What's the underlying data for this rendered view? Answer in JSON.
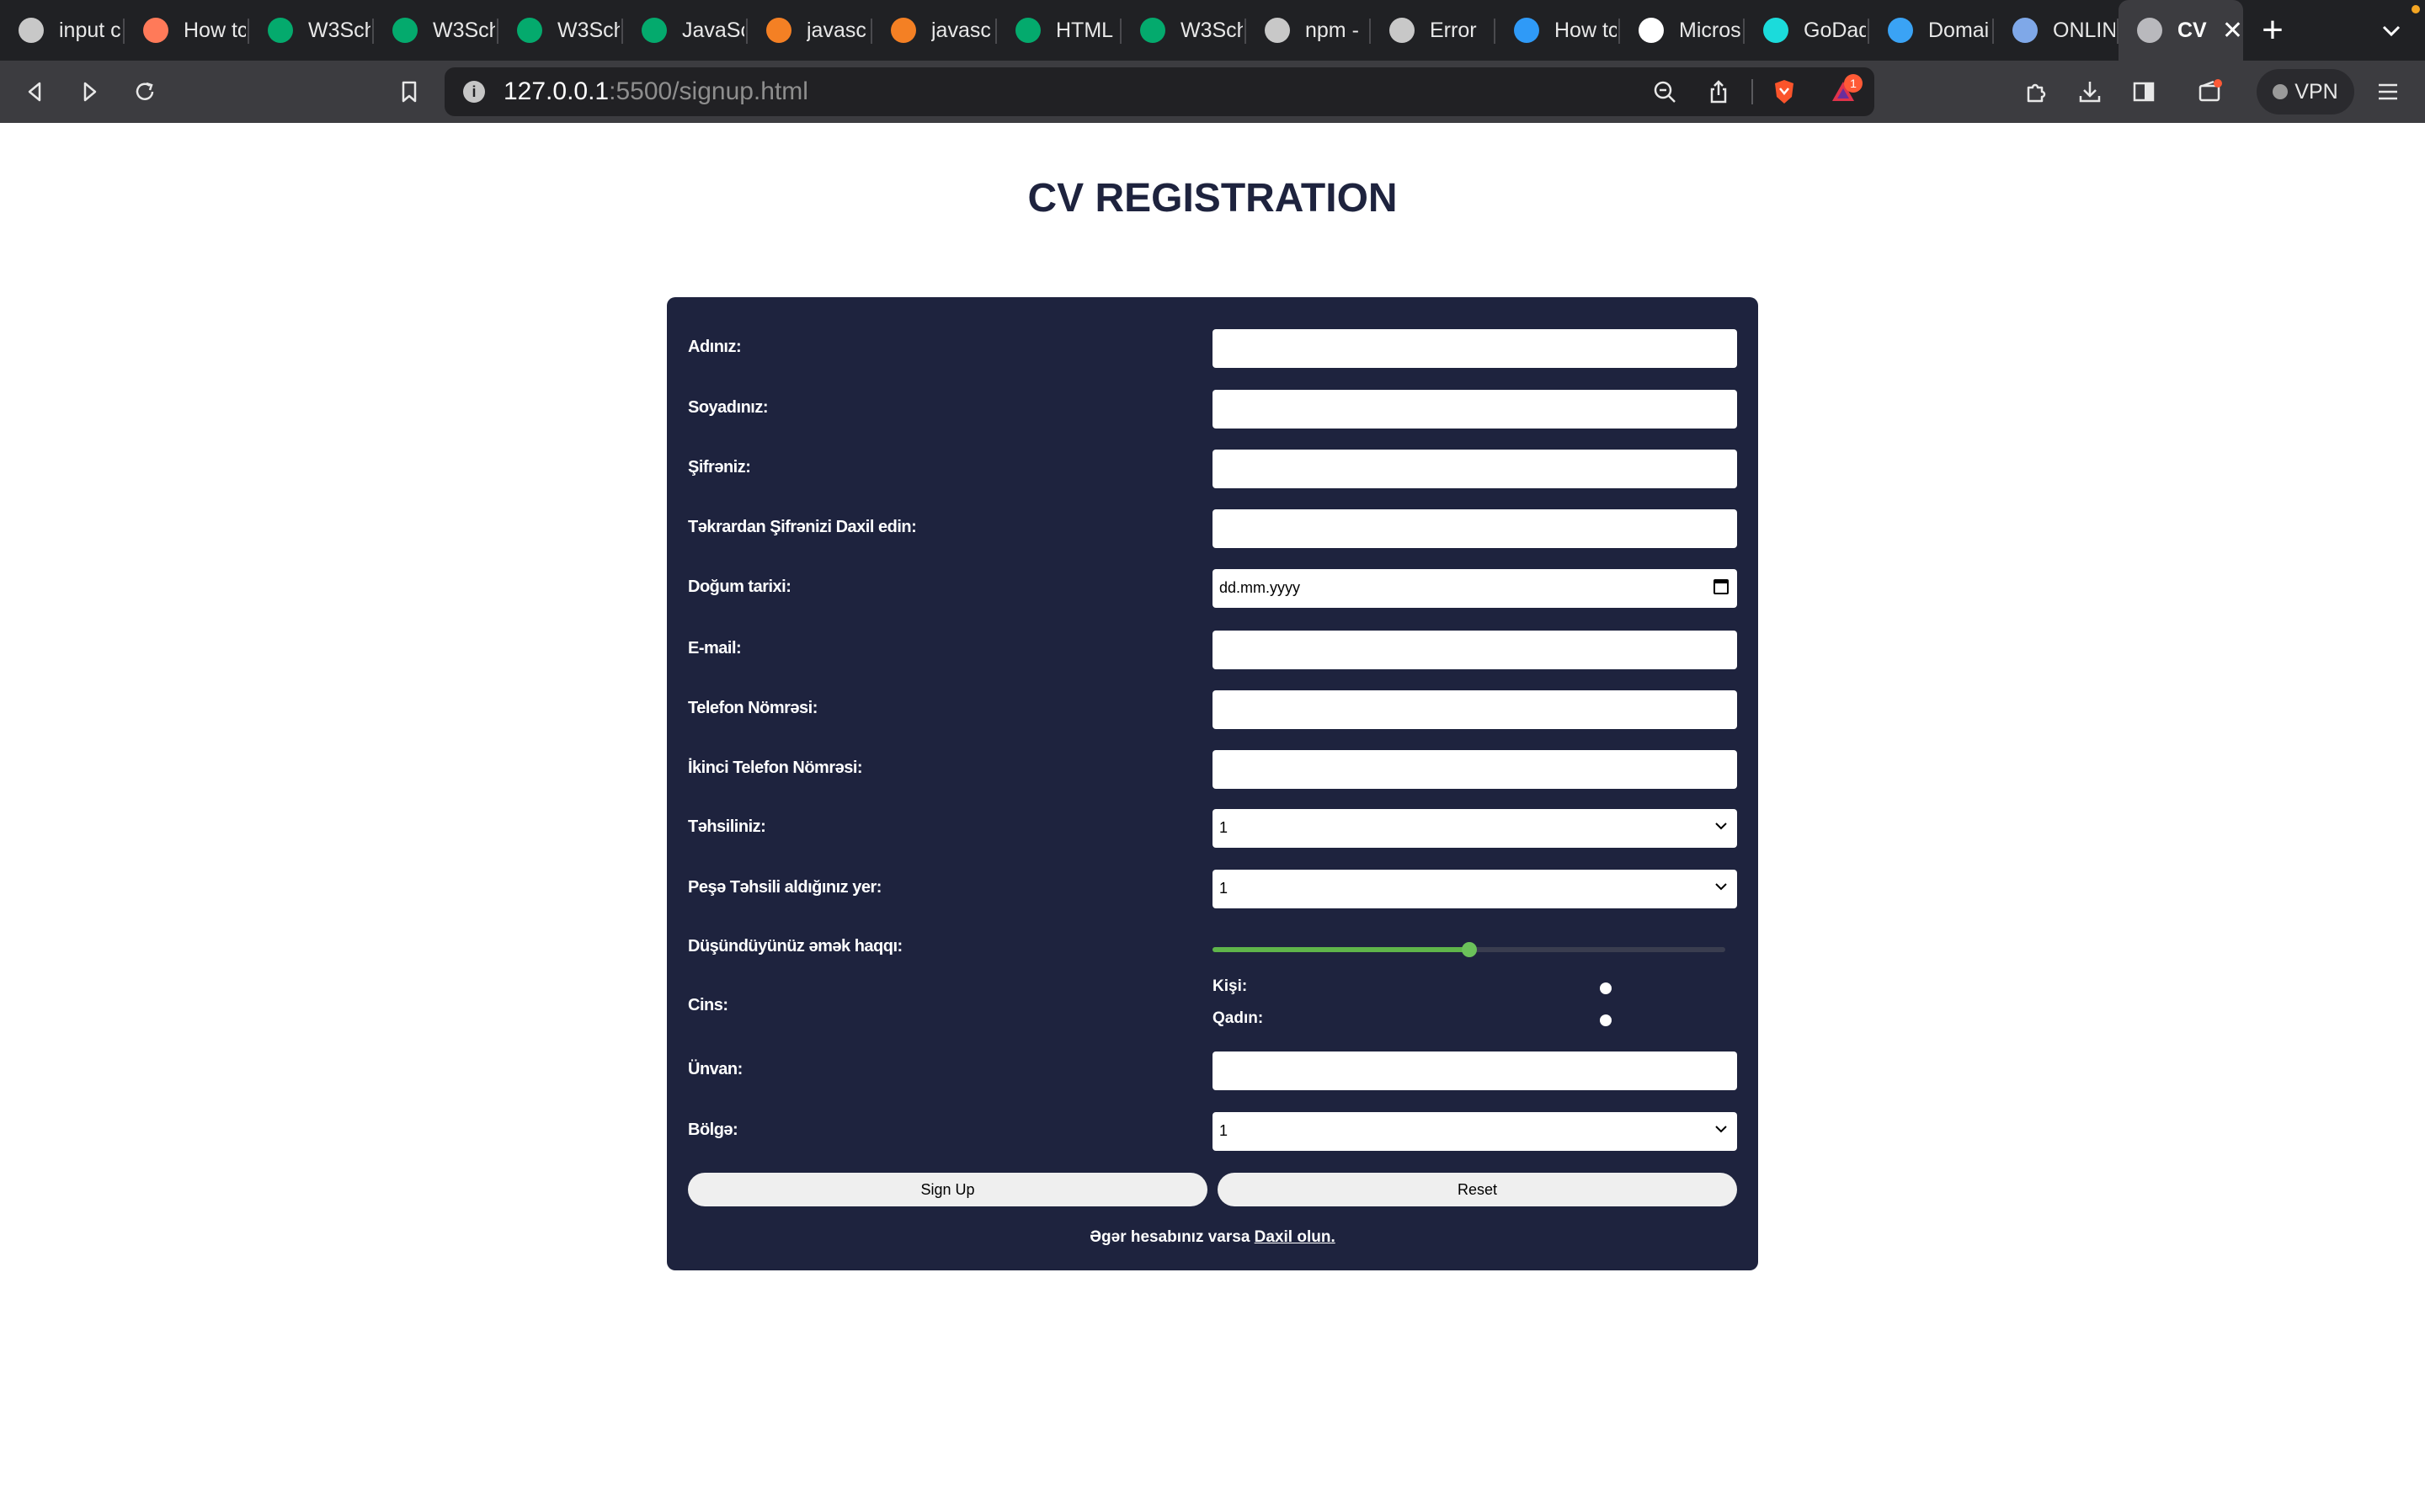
{
  "browser": {
    "tabs": [
      {
        "label": "input c",
        "icon": "globe-icon",
        "color": "#c8c8c8"
      },
      {
        "label": "How tc",
        "icon": "hubspot-icon",
        "color": "#ff7a59"
      },
      {
        "label": "W3Sch",
        "icon": "w3schools-icon",
        "color": "#04aa6d"
      },
      {
        "label": "W3Sch",
        "icon": "w3schools-icon",
        "color": "#04aa6d"
      },
      {
        "label": "W3Sch",
        "icon": "w3schools-icon",
        "color": "#04aa6d"
      },
      {
        "label": "JavaSc",
        "icon": "w3schools-icon",
        "color": "#04aa6d"
      },
      {
        "label": "javasc",
        "icon": "stackoverflow-icon",
        "color": "#f48024"
      },
      {
        "label": "javasc",
        "icon": "stackoverflow-icon",
        "color": "#f48024"
      },
      {
        "label": "HTML",
        "icon": "w3schools-icon",
        "color": "#04aa6d"
      },
      {
        "label": "W3Sch",
        "icon": "w3schools-icon",
        "color": "#04aa6d"
      },
      {
        "label": "npm -",
        "icon": "globe-icon",
        "color": "#c8c8c8"
      },
      {
        "label": "Error",
        "icon": "globe-icon",
        "color": "#c8c8c8"
      },
      {
        "label": "How tc",
        "icon": "squares-icon",
        "color": "#2f9af7"
      },
      {
        "label": "Micros",
        "icon": "google-icon",
        "color": "#ffffff"
      },
      {
        "label": "GoDad",
        "icon": "godaddy-icon",
        "color": "#1bdbdb"
      },
      {
        "label": "Domai",
        "icon": "check-icon",
        "color": "#3aa3f5"
      },
      {
        "label": "ONLIN",
        "icon": "earth-icon",
        "color": "#7fa8e8"
      }
    ],
    "active_tab": {
      "label": "CV",
      "icon": "globe-icon",
      "close": "✕"
    },
    "new_tab": "+",
    "url_host": "127.0.0.1",
    "url_rest": ":5500/signup.html",
    "rewards_badge": "1",
    "vpn_label": "VPN"
  },
  "page": {
    "title": "CV REGISTRATION",
    "fields": [
      {
        "label": "Adınız:",
        "type": "text"
      },
      {
        "label": "Soyadınız:",
        "type": "text"
      },
      {
        "label": "Şifrəniz:",
        "type": "password"
      },
      {
        "label": "Təkrardan Şifrənizi Daxil edin:",
        "type": "password"
      },
      {
        "label": "Doğum tarixi:",
        "type": "date",
        "value": "dd.mm.yyyy"
      },
      {
        "label": "E-mail:",
        "type": "email"
      },
      {
        "label": "Telefon Nömrəsi:",
        "type": "tel"
      },
      {
        "label": "İkinci Telefon Nömrəsi:",
        "type": "tel"
      }
    ],
    "education": {
      "label": "Təhsiliniz:",
      "value": "1"
    },
    "professional_education": {
      "label": "Peşə Təhsili aldığınız yer:",
      "value": "1"
    },
    "salary": {
      "label": "Düşündüyünüz əmək haqqı:",
      "level": 0.5
    },
    "gender": {
      "label": "Cins:",
      "options": [
        "Kişi:",
        "Qadın:"
      ]
    },
    "address": {
      "label": "Ünvan:"
    },
    "region": {
      "label": "Bölgə:",
      "value": "1"
    },
    "signup_button": "Sign Up",
    "reset_button": "Reset",
    "footer_text": "Əgər hesabınız varsa ",
    "footer_link": "Daxil olun."
  }
}
